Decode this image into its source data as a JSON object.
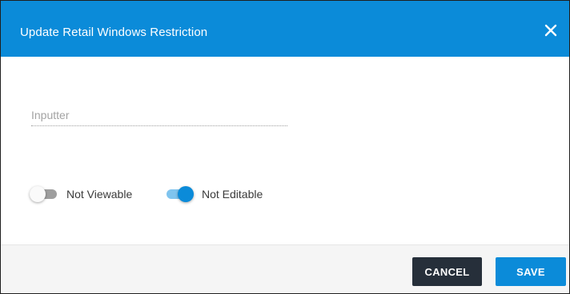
{
  "dialog": {
    "title": "Update Retail Windows Restriction",
    "close_icon": "close-icon"
  },
  "form": {
    "inputter": {
      "placeholder": "Inputter",
      "value": ""
    },
    "toggles": [
      {
        "label": "Not Viewable",
        "checked": false
      },
      {
        "label": "Not Editable",
        "checked": true
      }
    ]
  },
  "footer": {
    "cancel_label": "CANCEL",
    "save_label": "SAVE"
  },
  "colors": {
    "primary": "#0b8bd9",
    "cancel": "#262f3a",
    "footer_bg": "#f5f5f5"
  }
}
